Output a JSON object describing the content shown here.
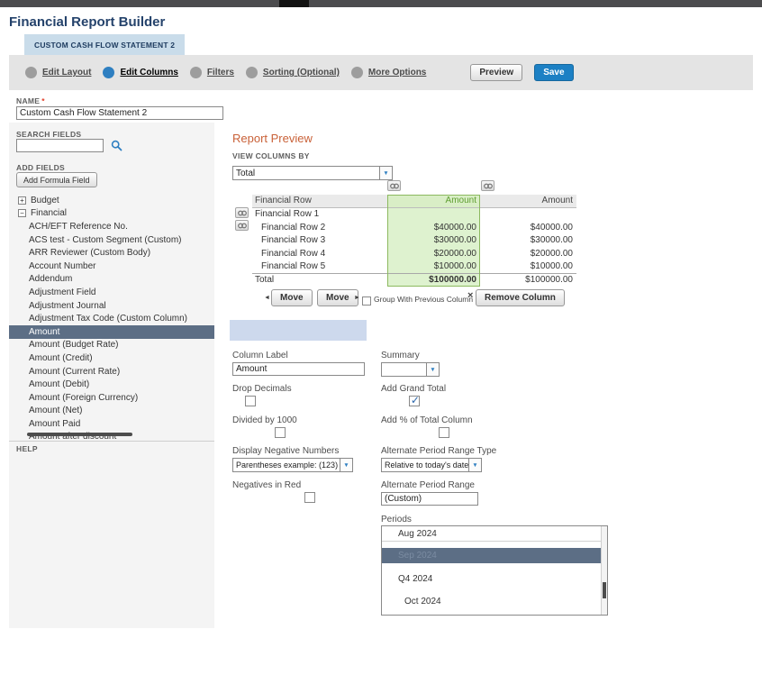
{
  "chrome": {
    "title": "Financial Report Builder",
    "tab_label": "CUSTOM CASH FLOW STATEMENT 2"
  },
  "stepper": {
    "steps": [
      "Edit Layout",
      "Edit Columns",
      "Filters",
      "Sorting (Optional)",
      "More Options"
    ],
    "active_step": "Edit Columns",
    "preview_button": "Preview",
    "save_button": "Save"
  },
  "name_field": {
    "label": "NAME",
    "required": "*",
    "value": "Custom Cash Flow Statement 2"
  },
  "sidebar": {
    "search_fields_label": "SEARCH FIELDS",
    "search_value": "",
    "add_fields_label": "ADD FIELDS",
    "add_formula_button": "Add Formula Field",
    "help_label": "HELP",
    "groups": [
      {
        "label": "Budget",
        "state": "collapsed",
        "glyph": "+"
      },
      {
        "label": "Financial",
        "state": "expanded",
        "glyph": "−"
      }
    ],
    "fields": [
      "ACH/EFT Reference No.",
      "ACS test - Custom Segment (Custom)",
      "ARR Reviewer (Custom Body)",
      "Account Number",
      "Addendum",
      "Adjustment Field",
      "Adjustment Journal",
      "Adjustment Tax Code (Custom Column)",
      "Amount",
      "Amount (Budget Rate)",
      "Amount (Credit)",
      "Amount (Current Rate)",
      "Amount (Debit)",
      "Amount (Foreign Currency)",
      "Amount (Net)",
      "Amount Paid",
      "Amount after discount"
    ],
    "selected_field": "Amount"
  },
  "report_preview": {
    "heading": "Report Preview",
    "view_columns_by_label": "VIEW COLUMNS BY",
    "view_columns_by_value": "Total",
    "table": {
      "headers": [
        "Financial Row",
        "Amount",
        "Amount"
      ],
      "rows": [
        {
          "label": "Financial Row 1",
          "col1": "",
          "col2": ""
        },
        {
          "label": "Financial Row 2",
          "col1": "$40000.00",
          "col2": "$40000.00"
        },
        {
          "label": "Financial Row 3",
          "col1": "$30000.00",
          "col2": "$30000.00"
        },
        {
          "label": "Financial Row 4",
          "col1": "$20000.00",
          "col2": "$20000.00"
        },
        {
          "label": "Financial Row 5",
          "col1": "$10000.00",
          "col2": "$10000.00"
        }
      ],
      "total": {
        "label": "Total",
        "col1": "$100000.00",
        "col2": "$100000.00"
      }
    },
    "move_left_button": "Move",
    "move_right_button": "Move",
    "group_with_previous_label": "Group With Previous Column",
    "group_with_previous_checked": false,
    "remove_column_button": "Remove Column"
  },
  "column_settings": {
    "column_label": {
      "label": "Column Label",
      "value": "Amount"
    },
    "summary": {
      "label": "Summary",
      "value": ""
    },
    "drop_decimals": {
      "label": "Drop Decimals",
      "checked": false
    },
    "add_grand_total": {
      "label": "Add Grand Total",
      "checked": true
    },
    "divided_by_1000": {
      "label": "Divided by 1000",
      "checked": false
    },
    "add_percent_of_total": {
      "label": "Add % of Total Column",
      "checked": false
    },
    "display_negative_numbers": {
      "label": "Display Negative Numbers",
      "value": "Parentheses  example: (123)"
    },
    "alternate_period_range_type": {
      "label": "Alternate Period Range Type",
      "value": "Relative to today's date"
    },
    "negatives_in_red": {
      "label": "Negatives in Red",
      "checked": false
    },
    "alternate_period_range": {
      "label": "Alternate Period Range",
      "value": "(Custom)"
    },
    "periods": {
      "label": "Periods",
      "options": [
        "Aug 2024",
        "Sep 2024",
        "Q4 2024",
        "Oct 2024"
      ],
      "selected": "Sep 2024"
    }
  },
  "icons": {
    "dropdown_arrow": "▼",
    "move_left": "◄",
    "move_right": "►",
    "remove": "×"
  },
  "colors": {
    "accent_blue": "#2e7fc1",
    "save_button_blue": "#1c80c4",
    "selected_row_slate": "#5c6e85",
    "selected_column_green_bg": "#def2cf",
    "selected_column_green_border": "#8cb95f",
    "heading_orange": "#c96138",
    "tab_blue_bg": "#c9dcea"
  }
}
